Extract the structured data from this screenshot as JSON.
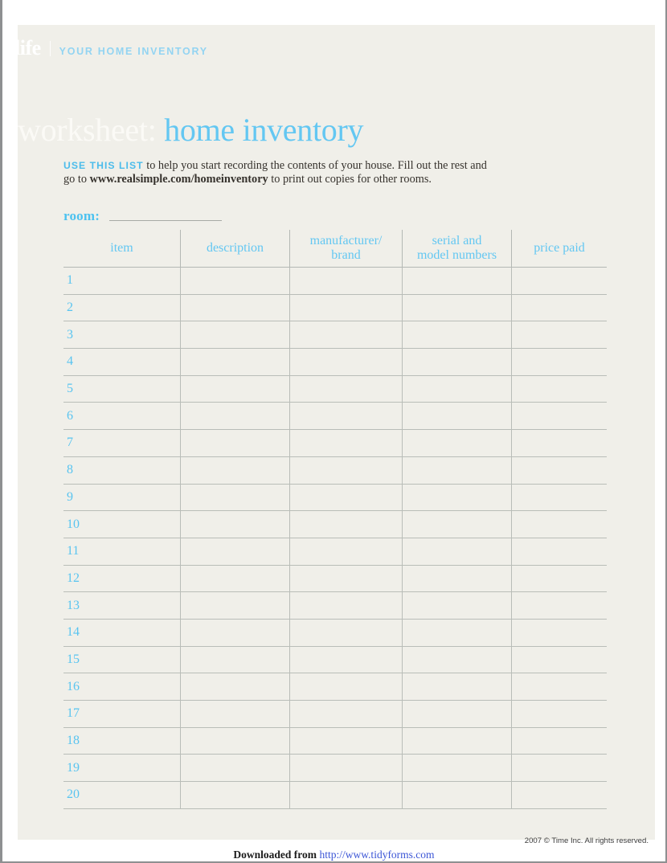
{
  "brand": {
    "logo": "life",
    "divider": "|",
    "subtitle": "YOUR HOME INVENTORY"
  },
  "title": {
    "prefix": "worksheet:",
    "highlight": "home inventory"
  },
  "intro": {
    "lead": "USE THIS LIST",
    "text_1": " to help you start recording the contents of your house. Fill out the rest and go to ",
    "url": "www.realsimple.com/homeinventory",
    "text_2": " to print out copies for other rooms."
  },
  "room": {
    "label": "room:",
    "value": ""
  },
  "table": {
    "columns": [
      "item",
      "description",
      "manufacturer/\nbrand",
      "serial and\nmodel numbers",
      "price paid"
    ],
    "column_lines": [
      [
        "item"
      ],
      [
        "description"
      ],
      [
        "manufacturer/",
        "brand"
      ],
      [
        "serial and",
        "model numbers"
      ],
      [
        "price paid"
      ]
    ],
    "rows": [
      {
        "n": "1",
        "item": "",
        "description": "",
        "manufacturer": "",
        "serial": "",
        "price": ""
      },
      {
        "n": "2",
        "item": "",
        "description": "",
        "manufacturer": "",
        "serial": "",
        "price": ""
      },
      {
        "n": "3",
        "item": "",
        "description": "",
        "manufacturer": "",
        "serial": "",
        "price": ""
      },
      {
        "n": "4",
        "item": "",
        "description": "",
        "manufacturer": "",
        "serial": "",
        "price": ""
      },
      {
        "n": "5",
        "item": "",
        "description": "",
        "manufacturer": "",
        "serial": "",
        "price": ""
      },
      {
        "n": "6",
        "item": "",
        "description": "",
        "manufacturer": "",
        "serial": "",
        "price": ""
      },
      {
        "n": "7",
        "item": "",
        "description": "",
        "manufacturer": "",
        "serial": "",
        "price": ""
      },
      {
        "n": "8",
        "item": "",
        "description": "",
        "manufacturer": "",
        "serial": "",
        "price": ""
      },
      {
        "n": "9",
        "item": "",
        "description": "",
        "manufacturer": "",
        "serial": "",
        "price": ""
      },
      {
        "n": "10",
        "item": "",
        "description": "",
        "manufacturer": "",
        "serial": "",
        "price": ""
      },
      {
        "n": "11",
        "item": "",
        "description": "",
        "manufacturer": "",
        "serial": "",
        "price": ""
      },
      {
        "n": "12",
        "item": "",
        "description": "",
        "manufacturer": "",
        "serial": "",
        "price": ""
      },
      {
        "n": "13",
        "item": "",
        "description": "",
        "manufacturer": "",
        "serial": "",
        "price": ""
      },
      {
        "n": "14",
        "item": "",
        "description": "",
        "manufacturer": "",
        "serial": "",
        "price": ""
      },
      {
        "n": "15",
        "item": "",
        "description": "",
        "manufacturer": "",
        "serial": "",
        "price": ""
      },
      {
        "n": "16",
        "item": "",
        "description": "",
        "manufacturer": "",
        "serial": "",
        "price": ""
      },
      {
        "n": "17",
        "item": "",
        "description": "",
        "manufacturer": "",
        "serial": "",
        "price": ""
      },
      {
        "n": "18",
        "item": "",
        "description": "",
        "manufacturer": "",
        "serial": "",
        "price": ""
      },
      {
        "n": "19",
        "item": "",
        "description": "",
        "manufacturer": "",
        "serial": "",
        "price": ""
      },
      {
        "n": "20",
        "item": "",
        "description": "",
        "manufacturer": "",
        "serial": "",
        "price": ""
      }
    ]
  },
  "footer": {
    "copyright": "2007 © Time Inc. All rights reserved.",
    "downloaded_label": "Downloaded from ",
    "downloaded_url": "http://www.tidyforms.com"
  },
  "colors": {
    "accent_blue": "#63c7f2",
    "sub_blue": "#93d4f2",
    "lead_blue": "#4cbceb",
    "sheet_bg": "#f0efe9",
    "rule": "#b9bdb8",
    "link": "#3b55d6",
    "page_border": "#8e9091"
  }
}
